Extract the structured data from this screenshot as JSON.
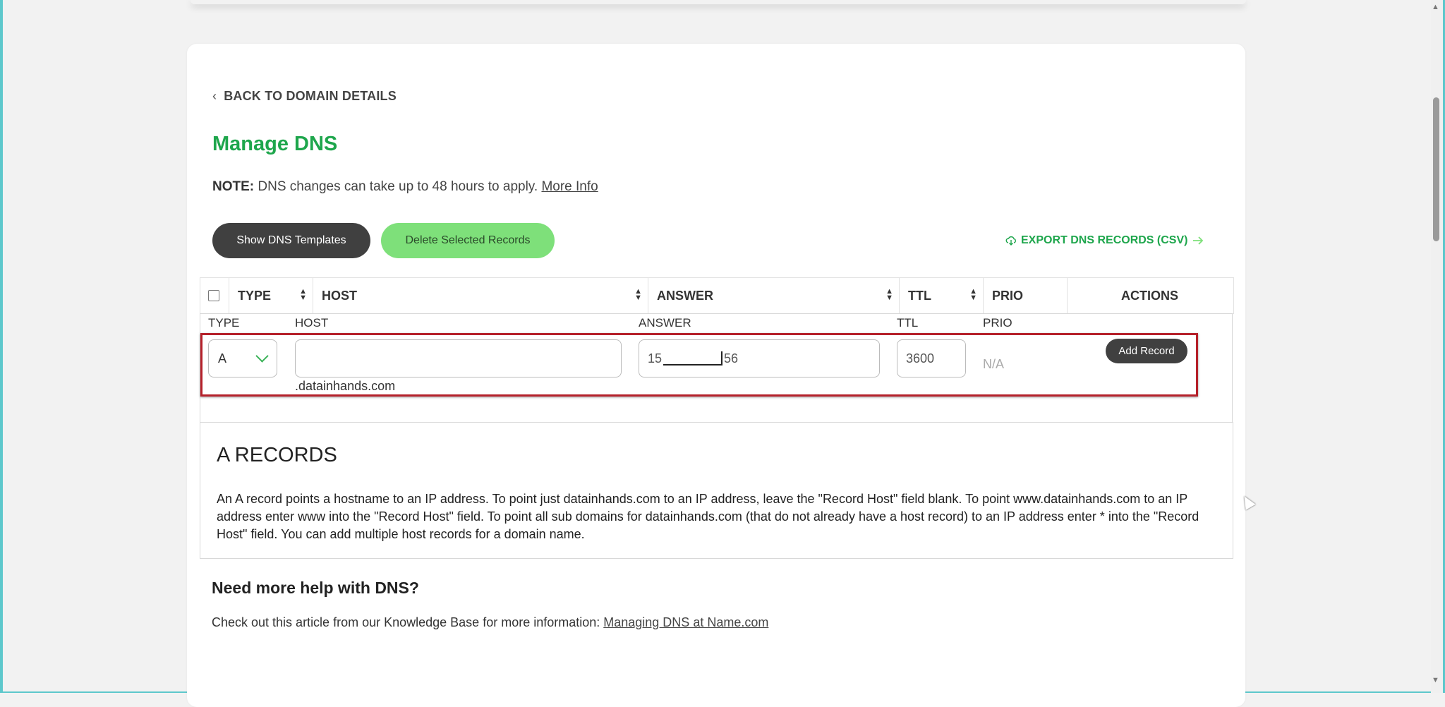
{
  "nav": {
    "back_label": "BACK TO DOMAIN DETAILS"
  },
  "page": {
    "title": "Manage DNS",
    "note_label": "NOTE:",
    "note_text": " DNS changes can take up to 48 hours to apply. ",
    "note_link": "More Info"
  },
  "toolbar": {
    "show_templates_label": "Show DNS Templates",
    "delete_selected_label": "Delete Selected Records",
    "export_label": "EXPORT DNS RECORDS (CSV)"
  },
  "table": {
    "columns": [
      "TYPE",
      "HOST",
      "ANSWER",
      "TTL",
      "PRIO",
      "ACTIONS"
    ]
  },
  "add_record": {
    "labels": {
      "type": "TYPE",
      "host": "HOST",
      "answer": "ANSWER",
      "ttl": "TTL",
      "prio": "PRIO"
    },
    "type_value": "A",
    "host_value": "",
    "answer_prefix": "15",
    "answer_suffix": "56",
    "ttl_value": "3600",
    "domain_suffix": ".datainhands.com",
    "prio_value": "N/A",
    "add_button_label": "Add Record"
  },
  "info": {
    "title": "A RECORDS",
    "text": "An A record points a hostname to an IP address. To point just datainhands.com to an IP address, leave the \"Record Host\" field blank. To point www.datainhands.com to an IP address enter www into the \"Record Host\" field. To point all sub domains for datainhands.com (that do not already have a host record) to an IP address enter * into the \"Record Host\" field. You can add multiple host records for a domain name."
  },
  "help": {
    "title": "Need more help with DNS?",
    "text": "Check out this article from our Knowledge Base for more information: ",
    "link": "Managing DNS at Name.com"
  },
  "colors": {
    "brand_green": "#1ea64c",
    "button_green": "#7ee07a",
    "button_dark": "#404040",
    "highlight_red": "#b5202a"
  }
}
